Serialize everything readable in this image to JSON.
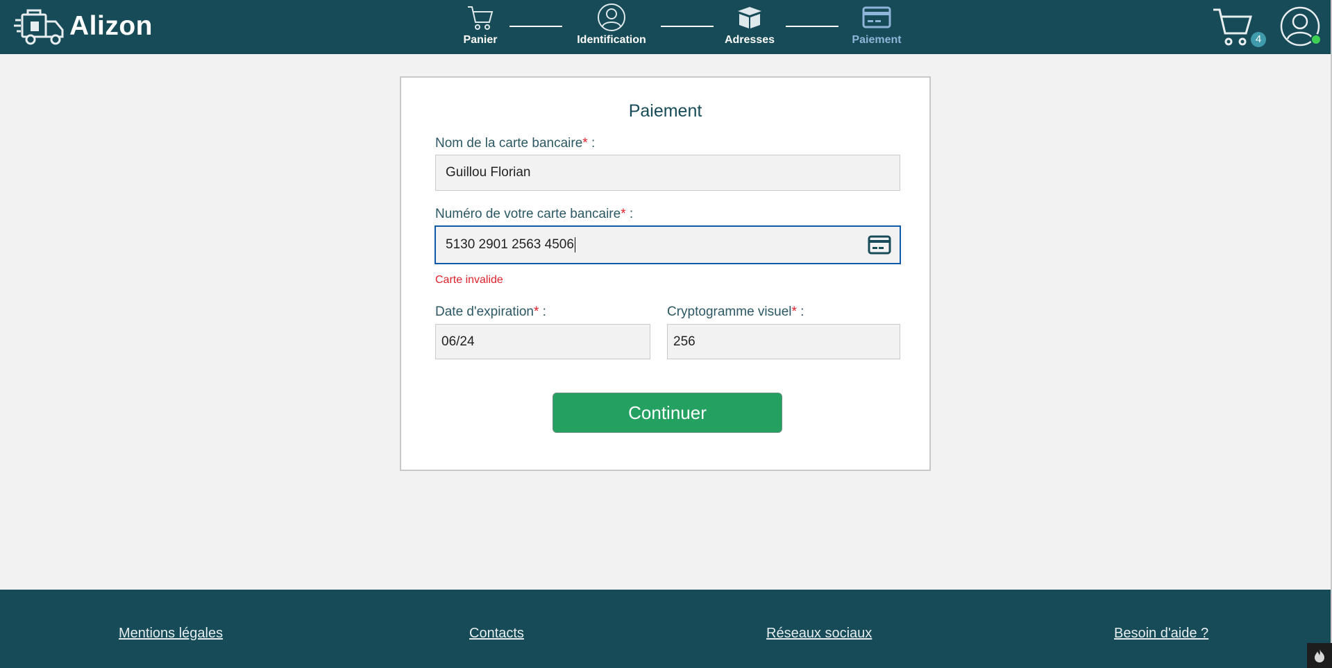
{
  "brand": {
    "name": "Alizon"
  },
  "steps": [
    {
      "label": "Panier",
      "icon": "cart-icon",
      "state": "done"
    },
    {
      "label": "Identification",
      "icon": "user-icon",
      "state": "done"
    },
    {
      "label": "Adresses",
      "icon": "box-icon",
      "state": "done"
    },
    {
      "label": "Paiement",
      "icon": "credit-card-icon",
      "state": "active"
    }
  ],
  "header": {
    "cart_count": "4"
  },
  "form": {
    "title": "Paiement",
    "card_name_label": "Nom de la carte bancaire",
    "card_name_value": "Guillou Florian",
    "card_number_label": "Numéro de votre carte bancaire",
    "card_number_value": "5130 2901 2563 4506",
    "card_number_error": "Carte invalide",
    "expiry_label": "Date d'expiration",
    "expiry_value": "06/24",
    "cvv_label": "Cryptogramme visuel",
    "cvv_value": "256",
    "required_mark": "*",
    "label_suffix": " :",
    "submit_label": "Continuer"
  },
  "footer": {
    "links": [
      "Mentions légales",
      "Contacts",
      "Réseaux sociaux",
      "Besoin d'aide ?"
    ]
  },
  "colors": {
    "header_bg": "#174b57",
    "accent_active": "#8fb6d8",
    "error": "#e0202a",
    "button": "#24a061",
    "focus": "#0e5aa8"
  }
}
